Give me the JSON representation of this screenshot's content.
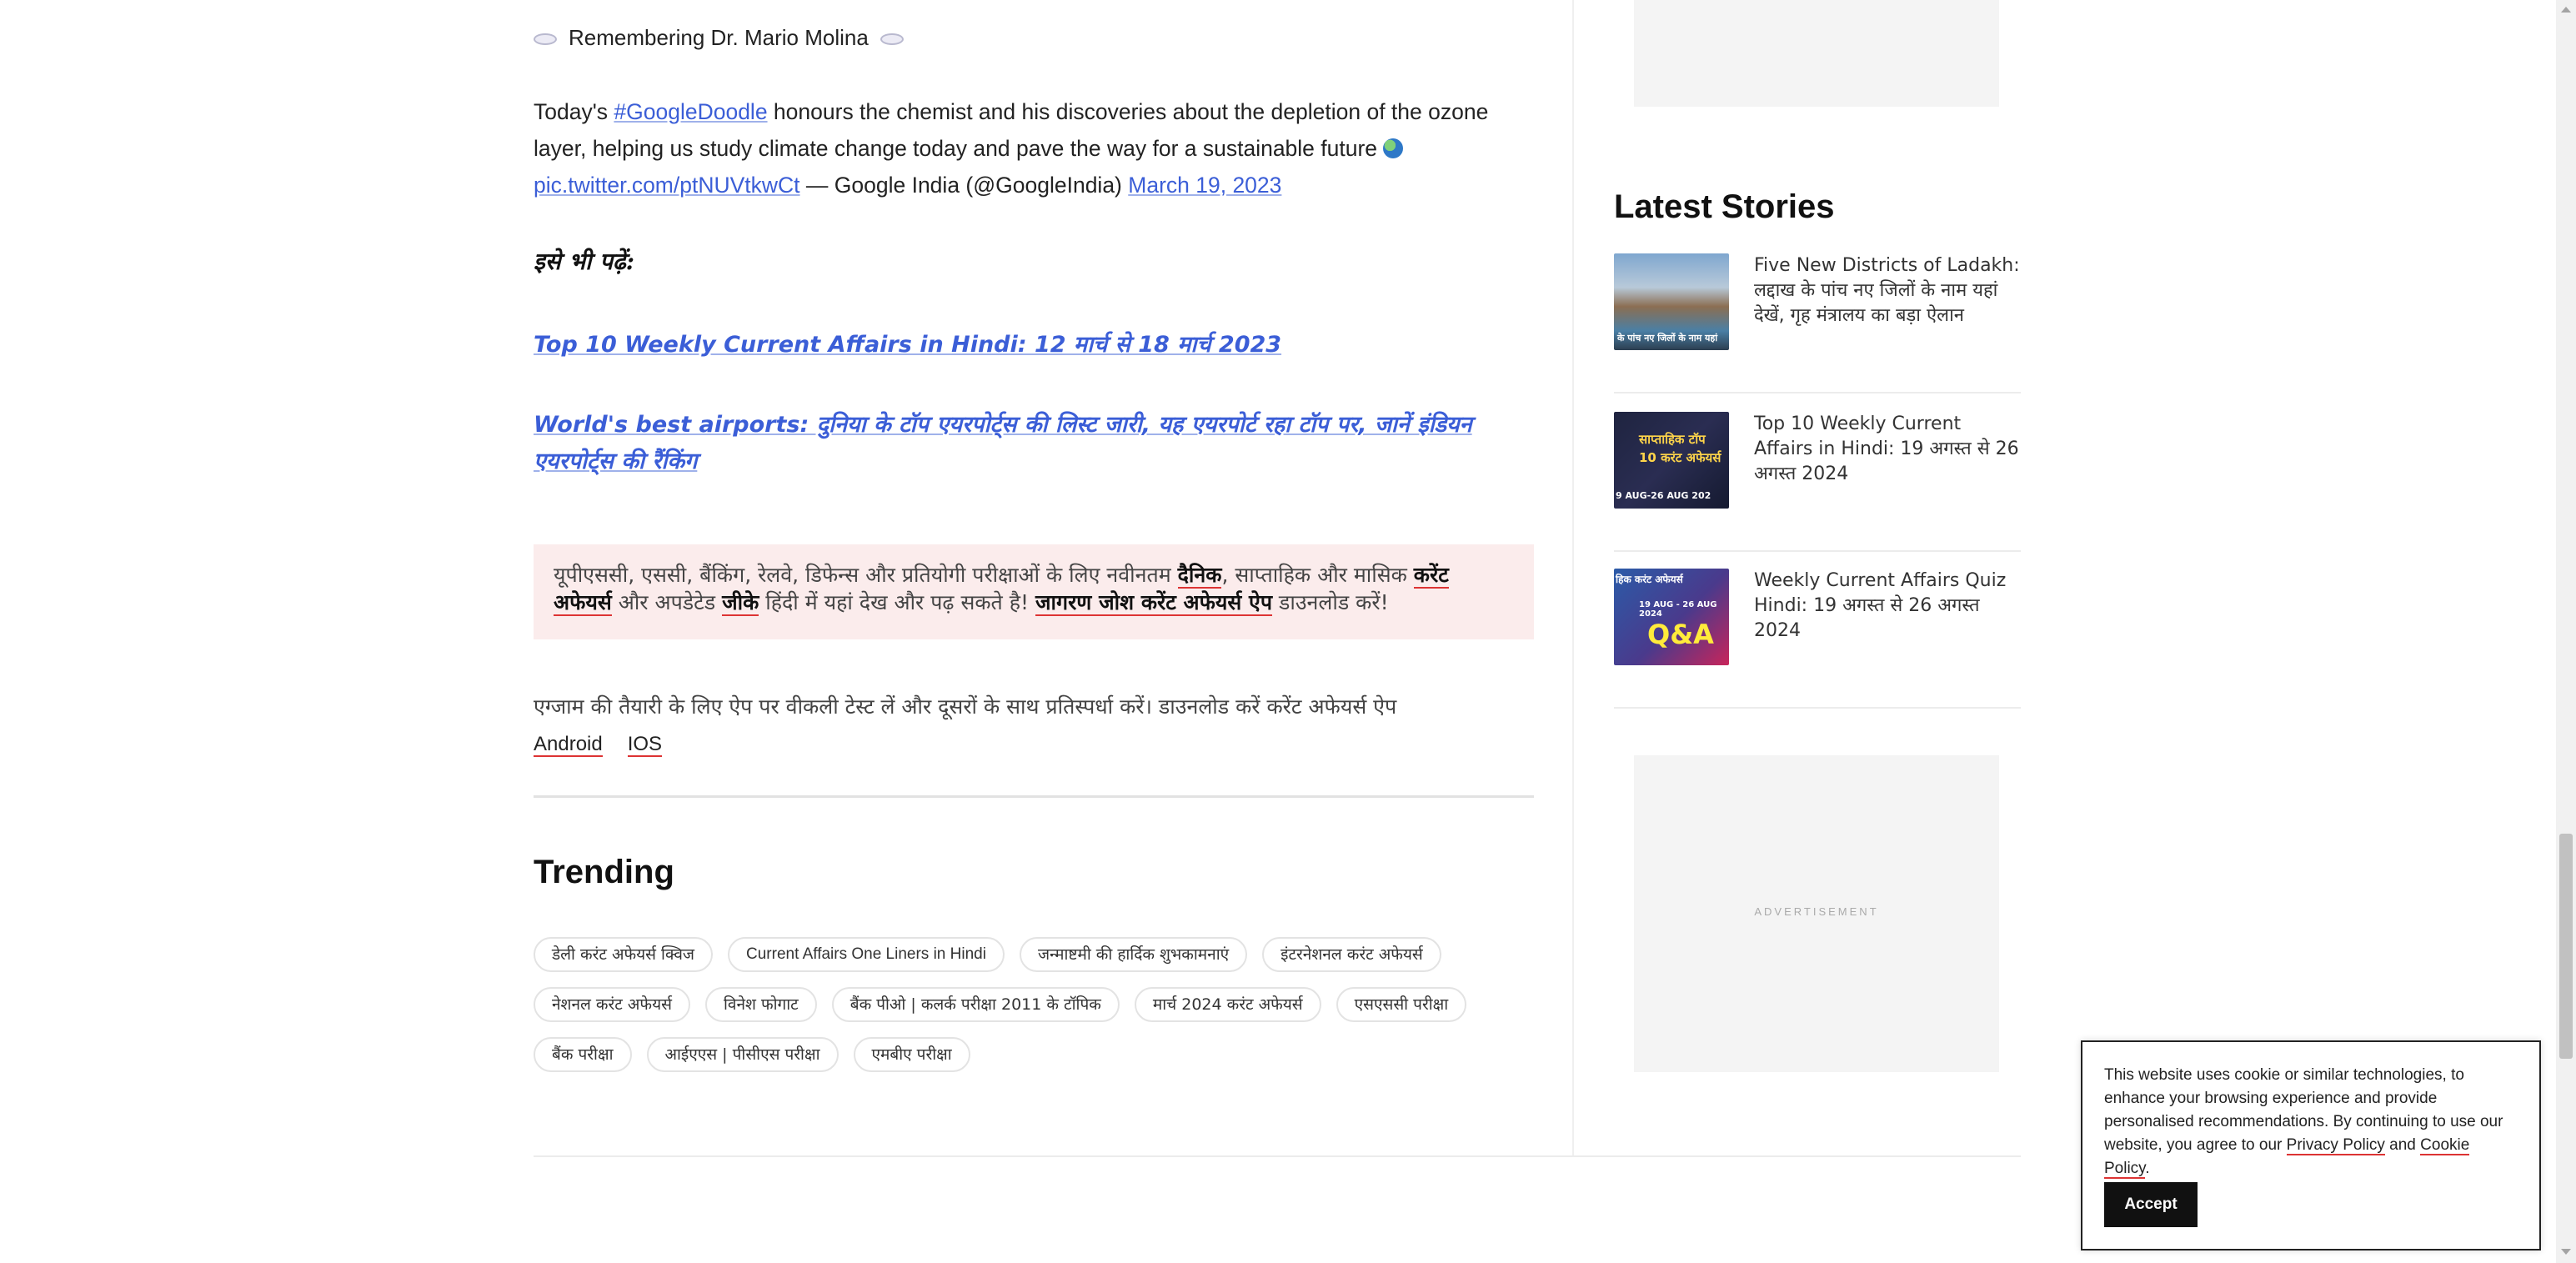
{
  "article": {
    "tweet_heading": "Remembering Dr. Mario Molina",
    "tweet_prefix": "Today's ",
    "tweet_hashtag": "#GoogleDoodle",
    "tweet_text": " honours the chemist and his discoveries about the depletion of the ozone layer, helping us study climate change today and pave the way for a sustainable future ",
    "tweet_pic_link": "pic.twitter.com/ptNUVtkwCt",
    "tweet_author": " — Google India (@GoogleIndia) ",
    "tweet_date": "March 19, 2023",
    "read_also_label": "इसे भी पढ़ें:",
    "related_links": [
      "Top 10 Weekly Current Affairs in Hindi: 12 मार्च से 18 मार्च 2023",
      "World's best airports: दुनिया के टॉप एयरपोर्ट्स की लिस्ट जारी, यह एयरपोर्ट रहा टॉप पर, जानें इंडियन एयरपोर्ट्स की रैंकिंग"
    ],
    "promo": {
      "part1": "यूपीएससी, एससी, बैंकिंग, रेलवे, डिफेन्स और प्रतियोगी परीक्षाओं के लिए नवीनतम ",
      "bold1": "दैनिक",
      "part2": ", साप्ताहिक और मासिक ",
      "bold2": "करेंट अफेयर्स",
      "part3": " और अपडेटेड ",
      "bold3": "जीके",
      "part4": " हिंदी में यहां देख और पढ़ सकते है! ",
      "bold4": "जागरण जोश करेंट अफेयर्स ऐप",
      "part5": " डाउनलोड करें!"
    },
    "app_line": "एग्जाम की तैयारी के लिए ऐप पर वीकली टेस्ट लें और दूसरों के साथ प्रतिस्पर्धा करें। डाउनलोड करें करेंट अफेयर्स ऐप",
    "app_links": [
      "Android",
      "IOS"
    ]
  },
  "trending": {
    "title": "Trending",
    "rows": [
      [
        "डेली करंट अफेयर्स क्विज",
        "Current Affairs One Liners in Hindi",
        "जन्माष्टमी की हार्दिक शुभकामनाएं",
        "इंटरनेशनल करंट अफेयर्स"
      ],
      [
        "नेशनल करंट अफेयर्स",
        "विनेश फोगाट",
        "बैंक पीओ | कलर्क परीक्षा 2011 के टॉपिक",
        "मार्च 2024 करंट अफेयर्स",
        "एसएससी परीक्षा"
      ],
      [
        "बैंक परीक्षा",
        "आईएएस | पीसीएस परीक्षा",
        "एमबीए परीक्षा"
      ]
    ]
  },
  "sidebar": {
    "latest_title": "Latest Stories",
    "stories": [
      {
        "title": "Five New Districts of Ladakh: लद्दाख के पांच नए जिलों के नाम यहां देखें, गृह मंत्रालय का बड़ा ऐलान",
        "thumb_text": "के पांच नए जिलों के नाम यहां"
      },
      {
        "title": "Top 10 Weekly Current Affairs in Hindi: 19 अगस्त से 26 अगस्त 2024",
        "thumb_text": "साप्ताहिक टॉप 10 करंट अफेयर्स",
        "thumb_date": "9 AUG-26 AUG 202"
      },
      {
        "title": "Weekly Current Affairs Quiz Hindi: 19 अगस्त से 26 अगस्त 2024",
        "thumb_text": "हिक करंट अफेयर्स",
        "thumb_date": "19 AUG - 26 AUG 2024",
        "thumb_badge": "Q&A"
      }
    ],
    "ad_label": "ADVERTISEMENT"
  },
  "cookie": {
    "text_before": "This website uses cookie or similar technologies, to enhance your browsing experience and provide personalised recommendations. By continuing to use our website, you agree to our ",
    "privacy_link": "Privacy Policy",
    "and": " and ",
    "cookie_link": "Cookie Policy",
    "end": ".",
    "accept_label": "Accept"
  }
}
